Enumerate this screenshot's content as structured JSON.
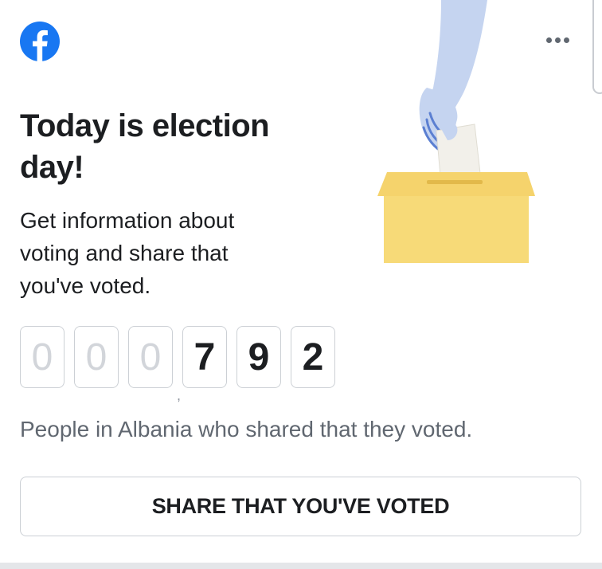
{
  "card": {
    "title": "Today is election day!",
    "subtitle": "Get information about voting and share that you've voted.",
    "counter": {
      "digits": [
        "0",
        "0",
        "0",
        "7",
        "9",
        "2"
      ],
      "muted_digits": 3,
      "separator": ","
    },
    "caption": "People in Albania who shared that they voted.",
    "share_button_label": "SHARE THAT YOU'VE VOTED"
  },
  "icons": {
    "logo": "facebook-logo-icon",
    "menu": "more-options-icon",
    "illustration": "ballot-box-hand-illustration"
  },
  "colors": {
    "brand": "#1877f2",
    "ballot_box": "#f7da78",
    "hand": "#c5d4f0",
    "text_primary": "#1c1e21",
    "text_secondary": "#606770"
  }
}
